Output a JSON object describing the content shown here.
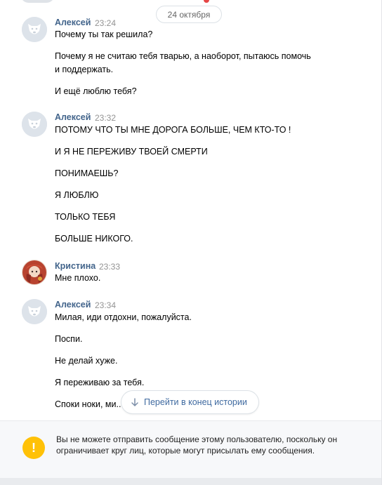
{
  "date_divider": "24 октября",
  "messages": [
    {
      "sender": "Алексей",
      "time": "23:24",
      "lines": [
        "Почему ты так решила?",
        "Почему я не считаю тебя тварью, а наоборот, пытаюсь помочь",
        "и поддержать.",
        "И ещё люблю тебя?"
      ]
    },
    {
      "sender": "Алексей",
      "time": "23:32",
      "lines": [
        "ПОТОМУ ЧТО ТЫ МНЕ ДОРОГА БОЛЬШЕ, ЧЕМ КТО-ТО !",
        "И Я НЕ ПЕРЕЖИВУ ТВОЕЙ СМЕРТИ",
        "ПОНИМАЕШЬ?",
        "Я ЛЮБЛЮ",
        "ТОЛЬКО ТЕБЯ",
        "БОЛЬШЕ НИКОГО."
      ]
    },
    {
      "sender": "Кристина",
      "time": "23:33",
      "lines": [
        "Мне плохо."
      ]
    },
    {
      "sender": "Алексей",
      "time": "23:34",
      "lines": [
        "Милая, иди отдохни, пожалуйста.",
        "Поспи.",
        "Не делай хуже.",
        "Я переживаю за тебя.",
        "Споки ноки, ми..."
      ]
    }
  ],
  "jump_button": {
    "label": "Перейти в конец истории",
    "icon": "arrow-down-icon"
  },
  "notice": {
    "icon": "warning-icon",
    "symbol": "!",
    "text": "Вы не можете отправить сообщение этому пользователю, поскольку он ограничивает круг лиц, которые могут присылать ему сообщения."
  },
  "colors": {
    "sender_name": "#42648b",
    "timestamp": "#939393",
    "link": "#3f6aa0",
    "warning": "#ffc107"
  }
}
